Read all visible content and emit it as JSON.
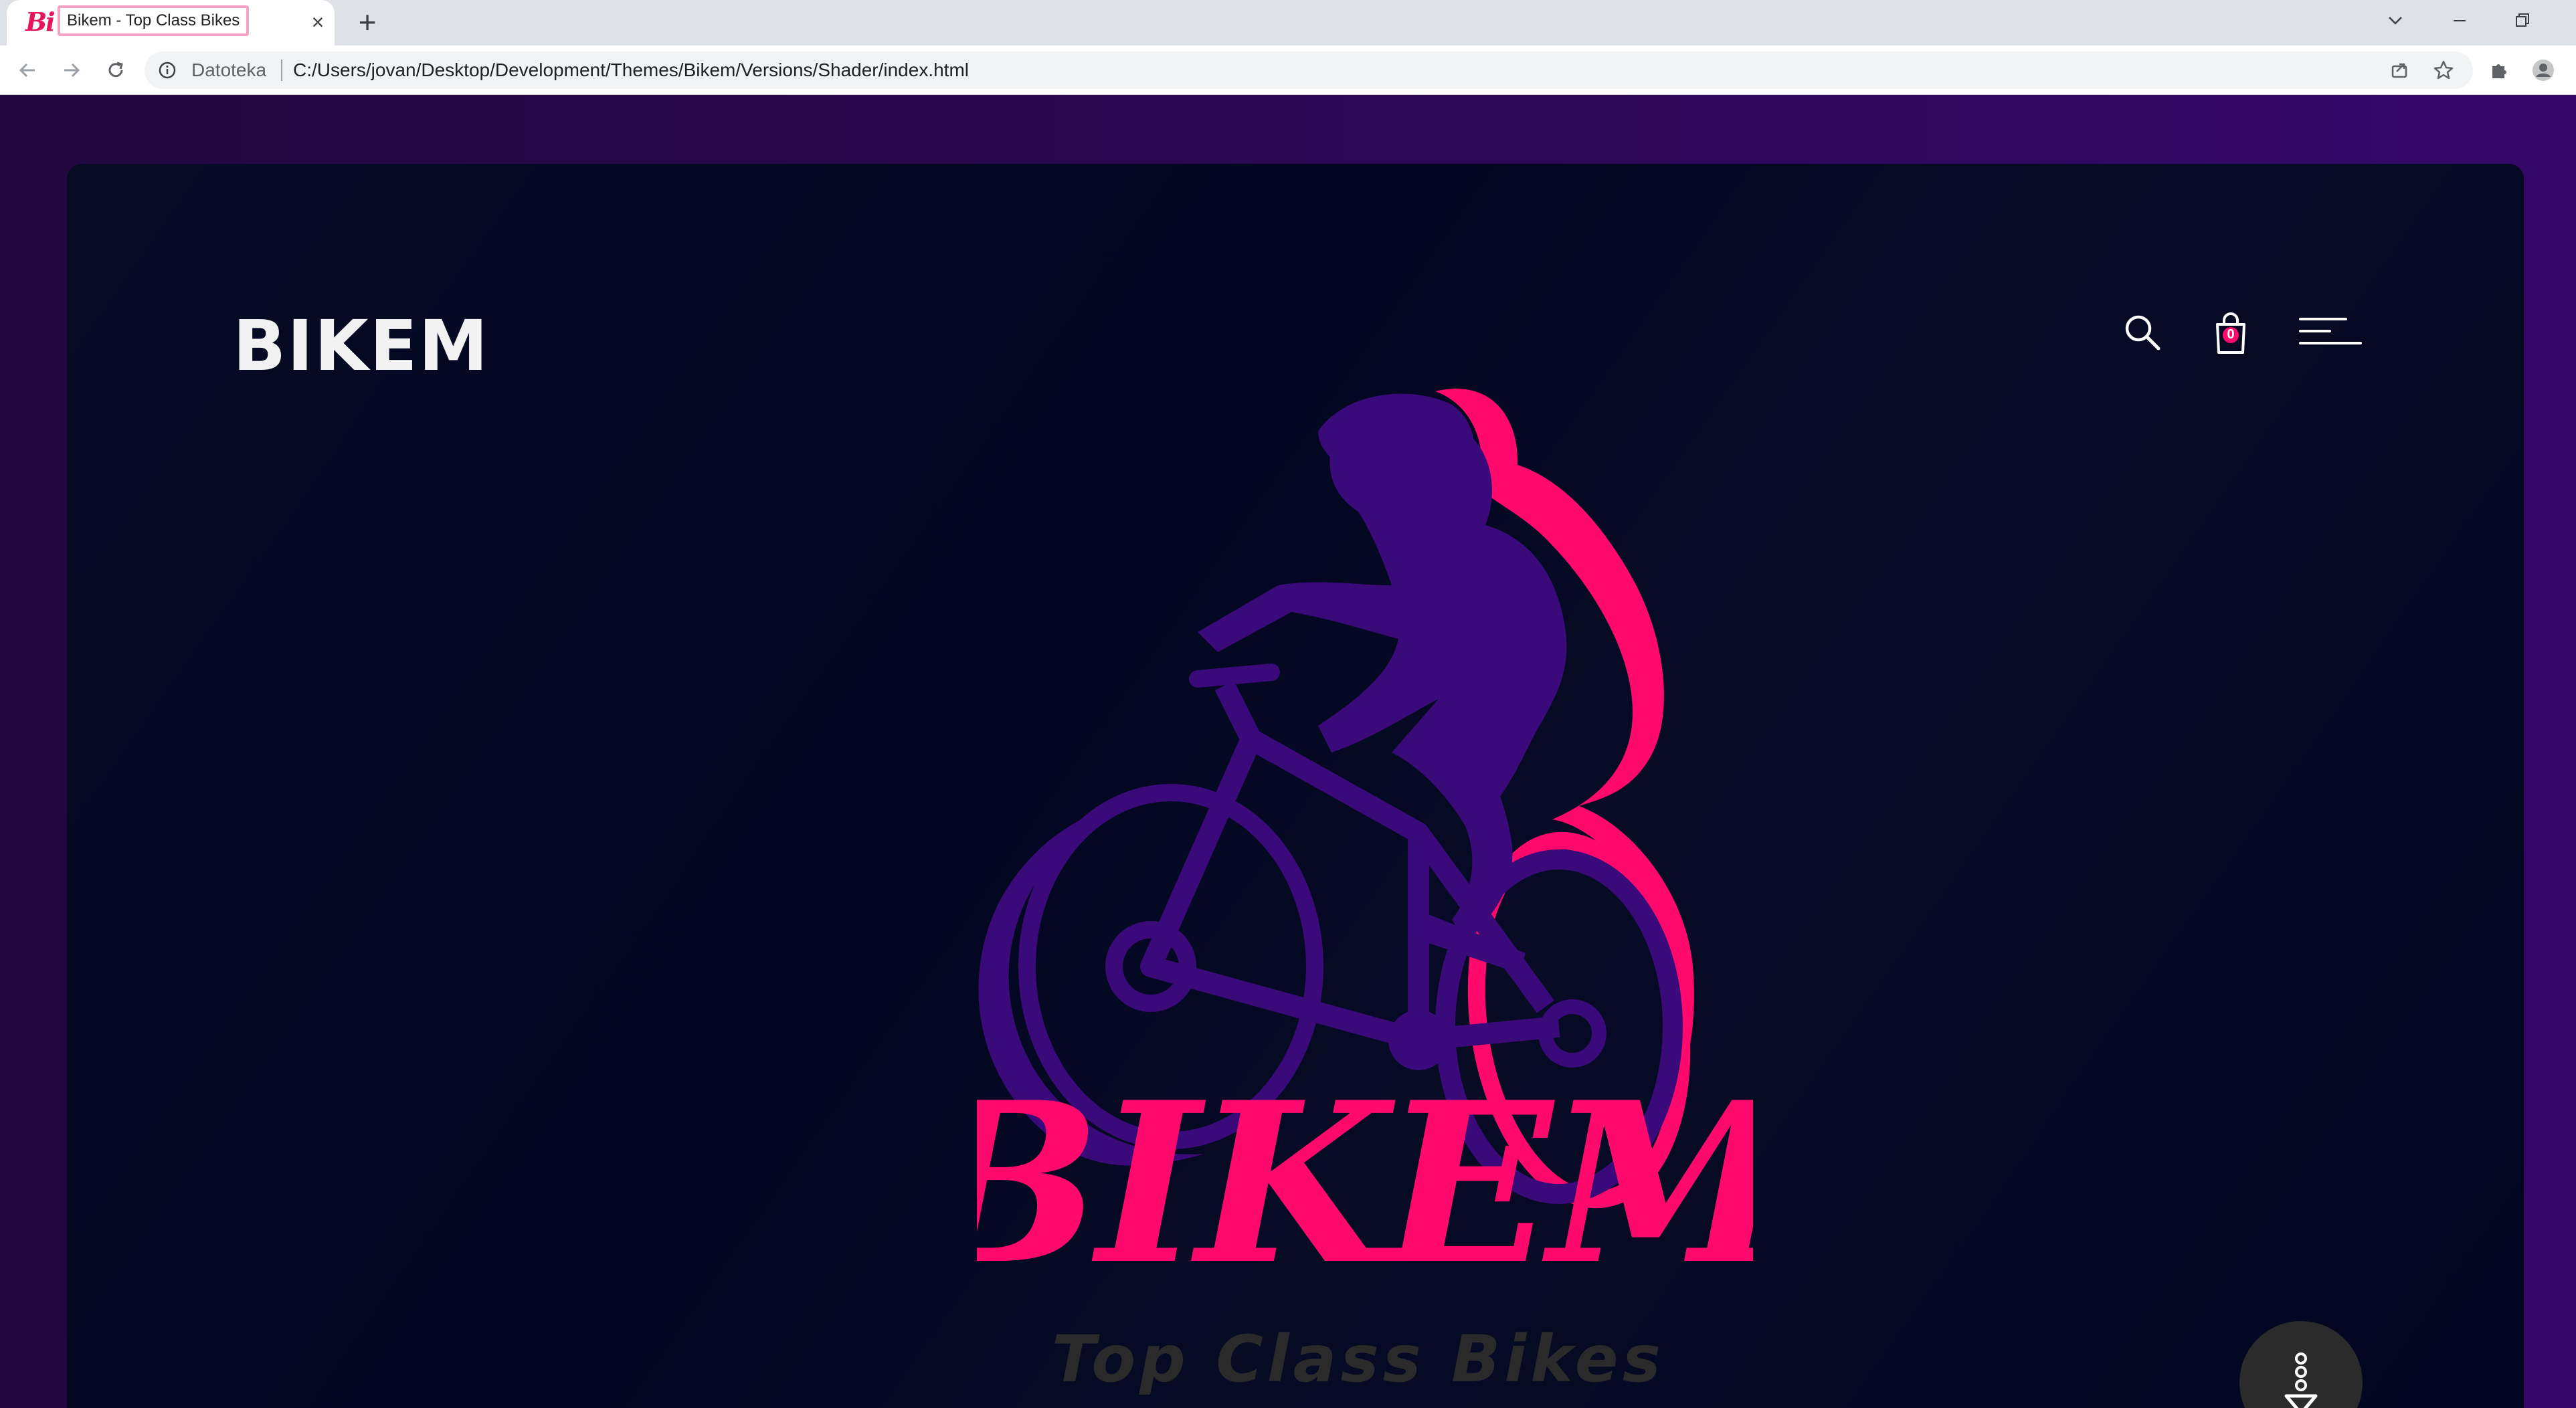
{
  "browser": {
    "tab": {
      "favicon_text": "Bi",
      "title": "Bikem - Top Class Bikes"
    },
    "site_info_label": "Datoteka",
    "url": "C:/Users/jovan/Desktop/Development/Themes/Bikem/Versions/Shader/index.html",
    "icons": [
      "back-icon",
      "forward-icon",
      "reload-icon",
      "info-icon",
      "share-icon",
      "star-icon",
      "puzzle-icon",
      "profile-icon",
      "chevron-down-icon",
      "minimize-icon",
      "restore-icon"
    ]
  },
  "site": {
    "logo_text": "BIKEM",
    "cart_count": "0",
    "hero_wordmark": "BIKEM",
    "hero_tagline": "Top Class Bikes",
    "colors": {
      "accent": "#ff0a6c",
      "rider_purple": "#3a0a7a",
      "tagline": "#2a2a2a",
      "hero_bg": "#020620",
      "page_bg": "#2a0750"
    },
    "icons": [
      "search-icon",
      "shopping-bag-icon",
      "menu-icon",
      "scroll-down-icon"
    ]
  }
}
